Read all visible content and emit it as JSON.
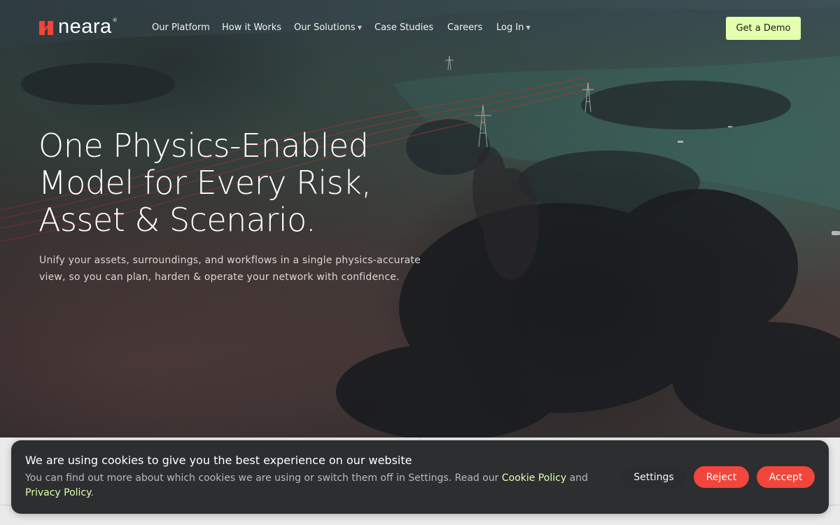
{
  "brand": {
    "name": "neara",
    "registered_mark": "®",
    "logo_color": "#f2453b"
  },
  "nav": {
    "items": [
      {
        "label": "Our Platform",
        "has_dropdown": false
      },
      {
        "label": "How it Works",
        "has_dropdown": false
      },
      {
        "label": "Our Solutions",
        "has_dropdown": true
      },
      {
        "label": "Case Studies",
        "has_dropdown": false
      },
      {
        "label": "Careers",
        "has_dropdown": false
      },
      {
        "label": "Log In",
        "has_dropdown": true
      }
    ],
    "dropdown_icon": "chevron-down-icon",
    "cta_label": "Get a Demo",
    "cta_color": "#e4ffad"
  },
  "hero": {
    "headline_lines": [
      "One Physics-Enabled",
      "Model for Every Risk,",
      "Asset & Scenario."
    ],
    "subcopy_lines": [
      "Unify your assets, surroundings, and workflows in a single physics-accurate",
      "view, so you can plan, harden & operate your network with confidence."
    ]
  },
  "cookie_banner": {
    "title": "We are using cookies to give you the best experience on our website",
    "body_text": "You can find out more about which cookies we are using or switch them off in Settings. Read our ",
    "cookie_policy_link": "Cookie Policy",
    "and_text": " and ",
    "privacy_policy_link": "Privacy Policy",
    "end_text": ".",
    "settings_label": "Settings",
    "reject_label": "Reject",
    "accept_label": "Accept",
    "accent_color": "#f2453b",
    "link_color": "#e4ffad"
  }
}
